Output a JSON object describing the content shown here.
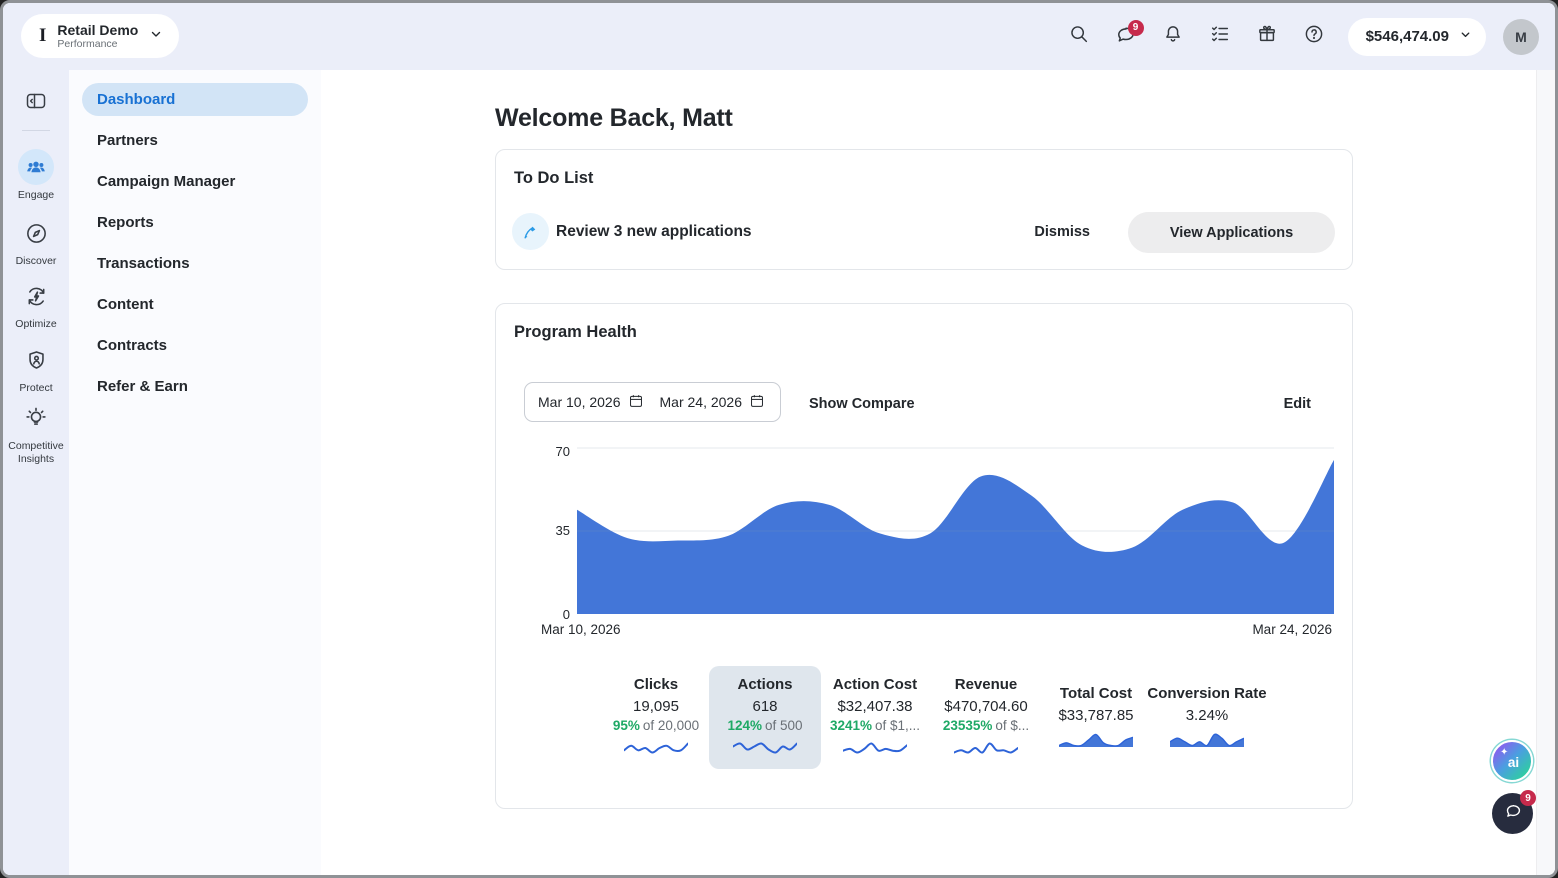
{
  "topbar": {
    "workspace": {
      "logo": "I",
      "name": "Retail Demo",
      "subtitle": "Performance"
    },
    "icon_names": [
      "search-icon",
      "chat-icon",
      "bell-icon",
      "tasks-checklist-icon",
      "gift-icon",
      "help-icon"
    ],
    "chat_badge": "9",
    "balance": "$546,474.09",
    "avatar_initial": "M"
  },
  "rail": {
    "items": [
      {
        "label": "Engage",
        "icon": "people-group-icon",
        "active": true
      },
      {
        "label": "Discover",
        "icon": "compass-icon",
        "active": false
      },
      {
        "label": "Optimize",
        "icon": "optimize-bolt-icon",
        "active": false
      },
      {
        "label": "Protect",
        "icon": "shield-icon",
        "active": false
      },
      {
        "label": "Competitive Insights",
        "icon": "lightbulb-icon",
        "active": false
      }
    ]
  },
  "sidebar": {
    "items": [
      {
        "label": "Dashboard",
        "active": true
      },
      {
        "label": "Partners",
        "active": false
      },
      {
        "label": "Campaign Manager",
        "active": false
      },
      {
        "label": "Reports",
        "active": false
      },
      {
        "label": "Transactions",
        "active": false
      },
      {
        "label": "Content",
        "active": false
      },
      {
        "label": "Contracts",
        "active": false
      },
      {
        "label": "Refer & Earn",
        "active": false
      }
    ]
  },
  "main": {
    "greeting": "Welcome Back, Matt",
    "todo": {
      "title": "To Do List",
      "task": "Review 3 new applications",
      "dismiss_label": "Dismiss",
      "cta_label": "View Applications"
    },
    "program_health": {
      "title": "Program Health",
      "date_start": "Mar 10, 2026",
      "date_end": "Mar 24, 2026",
      "show_compare_label": "Show Compare",
      "edit_label": "Edit"
    }
  },
  "chart_data": {
    "type": "area",
    "title": "Program Health",
    "x_labels": [
      "Mar 10, 2026",
      "Mar 24, 2026"
    ],
    "yticks": [
      "70",
      "35",
      "0"
    ],
    "ylim": [
      0,
      70
    ],
    "grid": true,
    "legend": false,
    "fill": "#4376d8",
    "series": [
      {
        "name": "Actions",
        "values": [
          44,
          32,
          31,
          33,
          46,
          46,
          34,
          34,
          58,
          50,
          29,
          28,
          44,
          47,
          30,
          65
        ]
      }
    ]
  },
  "metrics": [
    {
      "label": "Clicks",
      "value": "19,095",
      "pct": "95%",
      "goal": "of 20,000",
      "selected": false,
      "spark_type": "line",
      "spark": [
        4,
        6,
        4,
        5,
        3,
        5,
        6,
        4,
        4,
        7
      ]
    },
    {
      "label": "Actions",
      "value": "618",
      "pct": "124%",
      "goal": "of 500",
      "selected": true,
      "spark_type": "line",
      "spark": [
        5,
        6,
        4,
        5,
        6,
        4,
        3,
        5,
        4,
        6
      ]
    },
    {
      "label": "Action Cost",
      "value": "$32,407.38",
      "pct": "3241%",
      "goal": "of $1,...",
      "selected": false,
      "spark_type": "line",
      "spark": [
        4,
        5,
        3,
        5,
        8,
        4,
        5,
        4,
        4,
        7
      ]
    },
    {
      "label": "Revenue",
      "value": "$470,704.60",
      "pct": "23535%",
      "goal": "of $...",
      "selected": false,
      "spark_type": "line",
      "spark": [
        4,
        5,
        4,
        6,
        4,
        8,
        5,
        5,
        4,
        6
      ]
    },
    {
      "label": "Total Cost",
      "value": "$33,787.85",
      "selected": false,
      "spark_type": "area",
      "spark": [
        4,
        5,
        4,
        4,
        6,
        8,
        5,
        4,
        4,
        6,
        7
      ]
    },
    {
      "label": "Conversion Rate",
      "value": "3.24%",
      "selected": false,
      "spark_type": "area",
      "spark": [
        6,
        7,
        6,
        5,
        6,
        5,
        8,
        7,
        5,
        6,
        7
      ]
    }
  ],
  "fab": {
    "ai_label": "ai",
    "chat_badge": "9"
  },
  "colors": {
    "topbar_bg": "#ebeef9",
    "sidebar_bg": "#fafbfe",
    "active_nav_bg": "#d2e4f6",
    "active_nav_text": "#1871d3",
    "chart_fill": "#4376d8",
    "spark_stroke": "#2d63d8",
    "goal_green": "#1fa966",
    "badge_red": "#c62a4c",
    "ink": "#23272c",
    "muted": "#6a7076"
  }
}
